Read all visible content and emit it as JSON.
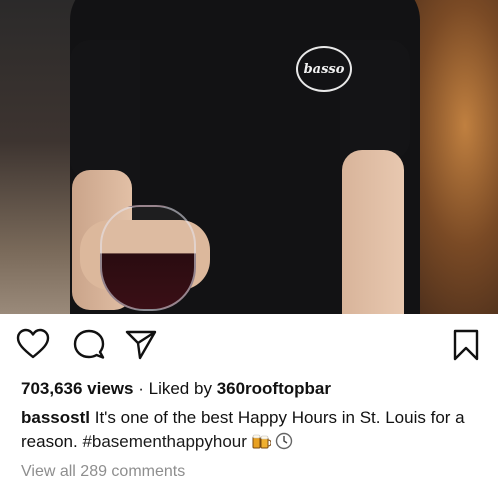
{
  "post": {
    "stats": {
      "views": "703,636 views",
      "separator": "·",
      "liked_prefix": "Liked by",
      "liked_by": "360rooftopbar"
    },
    "caption": {
      "username": "bassostl",
      "text": "It's one of the best Happy Hours in St. Louis for a reason.",
      "hashtag": "#basementhappyhour"
    },
    "view_all_comments": "View all 289 comments"
  },
  "photo": {
    "shirt_logo_text": "basso"
  },
  "icons": {
    "like": "heart-icon",
    "comment": "comment-bubble-icon",
    "share": "paper-plane-icon",
    "save": "bookmark-icon",
    "emoji": "beer-mugs-emoji",
    "clock": "clock-icon"
  },
  "colors": {
    "text": "#111111",
    "muted": "#8e8e8e",
    "background": "#ffffff"
  }
}
